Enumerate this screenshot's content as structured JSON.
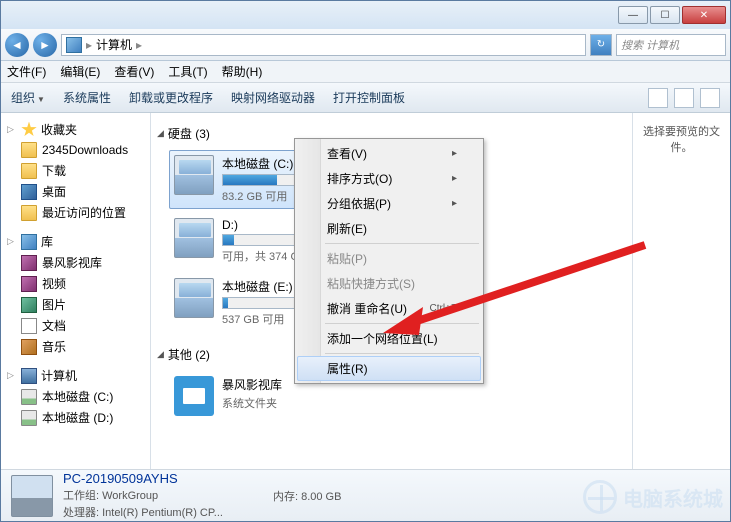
{
  "breadcrumb": {
    "root_icon": "computer-icon",
    "path": "计算机",
    "sep": "▸"
  },
  "searchbox": {
    "placeholder": "搜索 计算机"
  },
  "menubar": [
    "文件(F)",
    "编辑(E)",
    "查看(V)",
    "工具(T)",
    "帮助(H)"
  ],
  "toolbar": {
    "organize": "组织",
    "sysprops": "系统属性",
    "uninstall": "卸载或更改程序",
    "netdrive": "映射网络驱动器",
    "ctrlpanel": "打开控制面板"
  },
  "sidebar": {
    "favorites": {
      "label": "收藏夹",
      "items": [
        "2345Downloads",
        "下载",
        "桌面",
        "最近访问的位置"
      ]
    },
    "libraries": {
      "label": "库",
      "items": [
        "暴风影视库",
        "视频",
        "图片",
        "文档",
        "音乐"
      ]
    },
    "computer": {
      "label": "计算机",
      "items": [
        "本地磁盘 (C:)",
        "本地磁盘 (D:)"
      ]
    }
  },
  "sections": {
    "drives": {
      "label": "硬盘 (3)"
    },
    "other": {
      "label": "其他 (2)"
    }
  },
  "drives": [
    {
      "name": "本地磁盘 (C:)",
      "free": "83.2 GB 可用",
      "fill": 30,
      "selected": true
    },
    {
      "name": "D:)",
      "free": "可用，共 374 GB",
      "fill": 6,
      "selected": false
    },
    {
      "name": "本地磁盘 (E:)",
      "free": "537 GB 可用",
      "fill": 3,
      "selected": false
    }
  ],
  "other_items": [
    {
      "name": "暴风影视库",
      "sub": "系统文件夹"
    }
  ],
  "ctxmenu": {
    "view": "查看(V)",
    "sort": "排序方式(O)",
    "group": "分组依据(P)",
    "refresh": "刷新(E)",
    "paste": "粘贴(P)",
    "paste_shortcut": "粘贴快捷方式(S)",
    "undo": "撤消 重命名(U)",
    "undo_key": "Ctrl+Z",
    "addnet": "添加一个网络位置(L)",
    "props": "属性(R)"
  },
  "preview": {
    "text": "选择要预览的文件。"
  },
  "status": {
    "name": "PC-20190509AYHS",
    "workgroup_label": "工作组:",
    "workgroup": "WorkGroup",
    "cpu_label": "处理器:",
    "cpu": "Intel(R) Pentium(R) CP...",
    "mem_label": "内存:",
    "mem": "8.00 GB"
  },
  "watermark": "电脑系统城"
}
